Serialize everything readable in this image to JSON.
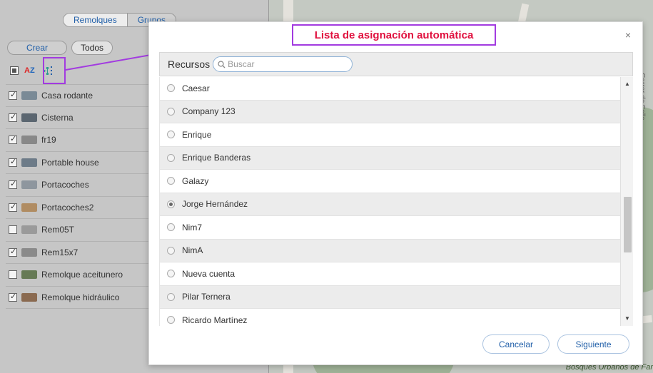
{
  "left_panel": {
    "tabs": [
      "Remolques",
      "Grupos"
    ],
    "create_label": "Crear",
    "filter_label": "Todos",
    "items": [
      {
        "label": "Casa rodante",
        "checked": true,
        "thumb_color": "#7a8a96"
      },
      {
        "label": "Cisterna",
        "checked": true,
        "thumb_color": "#5b6670"
      },
      {
        "label": "fr19",
        "checked": true,
        "thumb_color": "#888888"
      },
      {
        "label": "Portable house",
        "checked": true,
        "thumb_color": "#6d7b88"
      },
      {
        "label": "Portacoches",
        "checked": true,
        "thumb_color": "#8e969e"
      },
      {
        "label": "Portacoches2",
        "checked": true,
        "thumb_color": "#b08c62"
      },
      {
        "label": "Rem05T",
        "checked": false,
        "thumb_color": "#9a9a9a"
      },
      {
        "label": "Rem15x7",
        "checked": true,
        "thumb_color": "#8a8a8a"
      },
      {
        "label": "Remolque aceitunero",
        "checked": false,
        "thumb_color": "#667a55"
      },
      {
        "label": "Remolque hidráulico",
        "checked": true,
        "thumb_color": "#8a6a50"
      }
    ]
  },
  "dialog": {
    "title": "Lista de asignación automática",
    "close_icon": "close-icon",
    "resources_label": "Recursos",
    "search_placeholder": "Buscar",
    "resources": [
      {
        "name": "Caesar",
        "selected": false
      },
      {
        "name": "Company 123",
        "selected": false
      },
      {
        "name": "Enrique",
        "selected": false
      },
      {
        "name": "Enrique Banderas",
        "selected": false
      },
      {
        "name": "Galazy",
        "selected": false
      },
      {
        "name": "Jorge Hernández",
        "selected": true
      },
      {
        "name": "Nim7",
        "selected": false
      },
      {
        "name": "NimA",
        "selected": false
      },
      {
        "name": "Nueva cuenta",
        "selected": false
      },
      {
        "name": "Pilar Ternera",
        "selected": false
      },
      {
        "name": "Ricardo Martínez",
        "selected": false
      }
    ],
    "cancel_label": "Cancelar",
    "next_label": "Siguiente"
  },
  "map": {
    "label": "Bosques Urbanos de Far",
    "street_label": "Carrer de Falla"
  },
  "colors": {
    "highlight": "#a23be0",
    "title_text": "#e0103e",
    "link_blue": "#1f5ea8"
  }
}
